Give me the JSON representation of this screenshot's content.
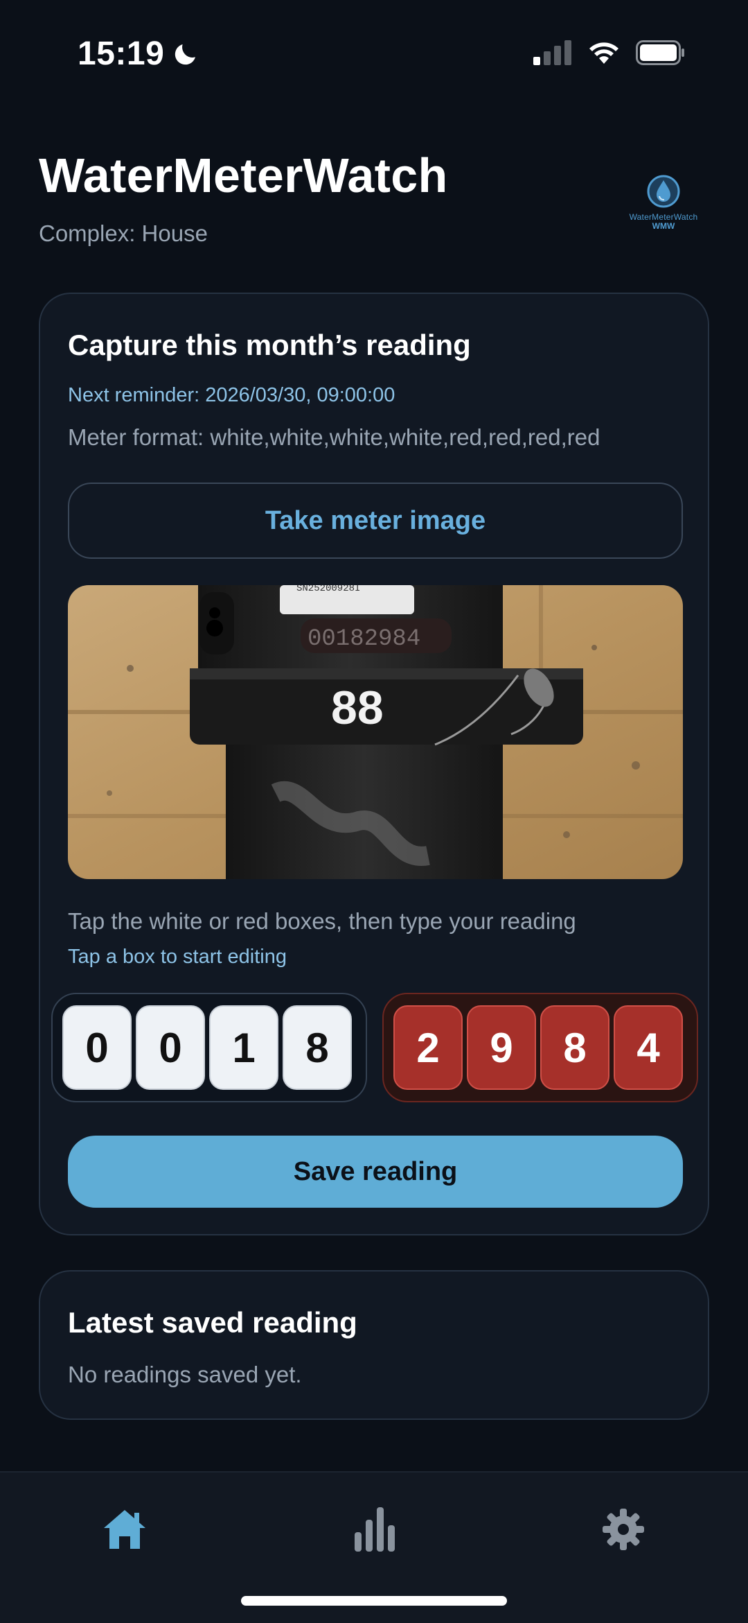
{
  "status_bar": {
    "time": "15:19"
  },
  "header": {
    "title": "WaterMeterWatch",
    "complex": "Complex: House",
    "logo_text": "WaterMeterWatch",
    "logo_sub": "WMW"
  },
  "capture": {
    "title": "Capture this month’s reading",
    "next_reminder": "Next reminder: 2026/03/30, 09:00:00",
    "meter_format": "Meter format: white,white,white,white,red,red,red,red",
    "take_image_label": "Take meter image",
    "hint_primary": "Tap the white or red boxes, then type your reading",
    "hint_secondary": "Tap a box to start editing",
    "white_digits": [
      "0",
      "0",
      "1",
      "8"
    ],
    "red_digits": [
      "2",
      "9",
      "8",
      "4"
    ],
    "save_label": "Save reading",
    "photo_label": "88",
    "photo_counter": "00182984",
    "photo_serial": "SN25200928I"
  },
  "latest": {
    "title": "Latest saved reading",
    "empty_text": "No readings saved yet."
  },
  "nav": {
    "items": [
      {
        "name": "home",
        "icon": "home-icon",
        "active": true
      },
      {
        "name": "stats",
        "icon": "bar-chart-icon",
        "active": false
      },
      {
        "name": "settings",
        "icon": "gear-icon",
        "active": false
      }
    ]
  },
  "colors": {
    "background": "#0b1018",
    "card": "#111823",
    "accent": "#5fadd6",
    "accent_text": "#69b0de",
    "red_digit": "#a6302a",
    "muted_text": "#9aa6b4"
  }
}
